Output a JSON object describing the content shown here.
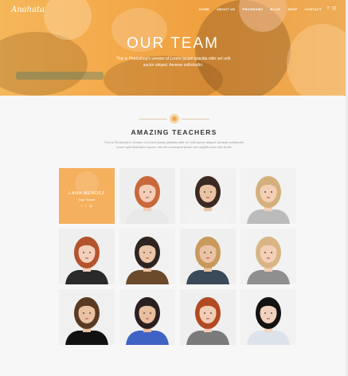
{
  "header": {
    "logo": "Anahata",
    "nav": [
      "HOME",
      "ABOUT US",
      "PROGRAMS",
      "BLOG",
      "SHOP",
      "CONTACT"
    ]
  },
  "hero": {
    "title": "OUR TEAM",
    "subtitle": "This is Photoshop's version of Lorem Ipsum gravida nibh vel velit auctor aliquet. Aenean sollicitudin."
  },
  "section": {
    "title": "AMAZING TEACHERS",
    "description": "This is Photoshop's version of Lorem Ipsum gravida nibh vel velit auctor aliquet. Aenean sollicitudin, lorem quis bibendum auctor, nisi elit consequat ipsum nec sagittis sem nibh id elit."
  },
  "featured": {
    "name": "LANA MENDEZ",
    "role": "Yoga Teacher"
  },
  "colors": {
    "accent": "#f0a03f",
    "featured_bg": "#f5b05e",
    "heading": "#333333"
  },
  "team": [
    {
      "hair": "#c9683a",
      "skin": "#f3cdb6",
      "top": "#e8e8e8",
      "bg": "#eeeeee"
    },
    {
      "hair": "#3b2a22",
      "skin": "#e9c3a4",
      "top": "#f2f2f2",
      "bg": "#f1f1f1"
    },
    {
      "hair": "#d3b07c",
      "skin": "#f2cfb5",
      "top": "#bbbbbb",
      "bg": "#f2f2f2"
    },
    {
      "hair": "#b4542c",
      "skin": "#f3d0bb",
      "top": "#2a2a2a",
      "bg": "#efefef"
    },
    {
      "hair": "#2e2420",
      "skin": "#ebc5a8",
      "top": "#6a4a2a",
      "bg": "#f2f2f2"
    },
    {
      "hair": "#c79a5c",
      "skin": "#eac3a5",
      "top": "#3b4a58",
      "bg": "#efefef"
    },
    {
      "hair": "#d9b585",
      "skin": "#f2cfb6",
      "top": "#8f8f8f",
      "bg": "#f2f2f2"
    },
    {
      "hair": "#5a3a22",
      "skin": "#eac2a2",
      "top": "#111111",
      "bg": "#f0f0f0"
    },
    {
      "hair": "#2b2020",
      "skin": "#e8bf9f",
      "top": "#3f63c4",
      "bg": "#f2f2f2"
    },
    {
      "hair": "#b14a22",
      "skin": "#f2cdb5",
      "top": "#7b7b7b",
      "bg": "#efefef"
    },
    {
      "hair": "#151212",
      "skin": "#f1d2bf",
      "top": "#dde3ea",
      "bg": "#f2f2f2"
    }
  ]
}
